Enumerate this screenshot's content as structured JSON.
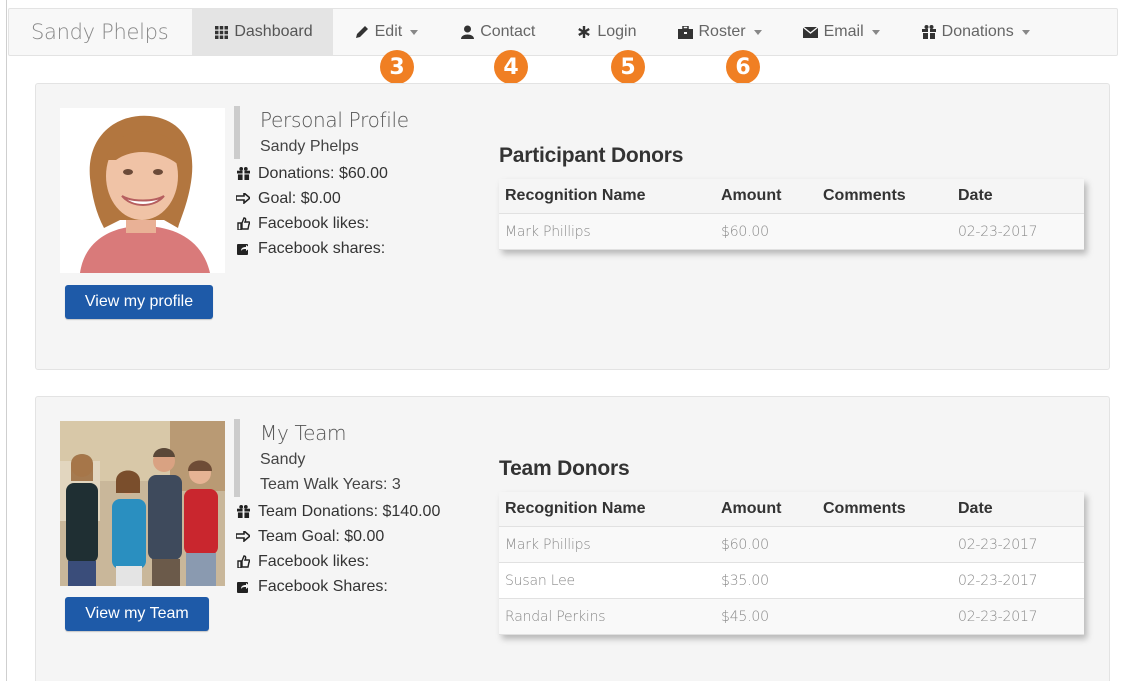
{
  "nav": {
    "brand": "Sandy Phelps",
    "items": [
      {
        "label": "Dashboard",
        "icon": "grid-icon"
      },
      {
        "label": "Edit",
        "icon": "pencil-icon"
      },
      {
        "label": "Contact",
        "icon": "user-icon"
      },
      {
        "label": "Login",
        "icon": "asterisk-icon"
      },
      {
        "label": "Roster",
        "icon": "briefcase-icon"
      },
      {
        "label": "Email",
        "icon": "envelope-icon"
      },
      {
        "label": "Donations",
        "icon": "gift-icon"
      }
    ],
    "badges": [
      "3",
      "4",
      "5",
      "6"
    ],
    "badge_color": "#f07f23"
  },
  "profile": {
    "title": "Personal Profile",
    "name": "Sandy Phelps",
    "donations": "Donations: $60.00",
    "goal": "Goal: $0.00",
    "fb_likes": "Facebook likes:",
    "fb_shares": "Facebook shares:",
    "button": "View my profile",
    "donors_title": "Participant Donors",
    "columns": [
      "Recognition Name",
      "Amount",
      "Comments",
      "Date"
    ],
    "rows": [
      {
        "name": "Mark Phillips",
        "amount": "$60.00",
        "comments": "",
        "date": "02-23-2017"
      }
    ]
  },
  "team": {
    "title": "My Team",
    "name": "Sandy",
    "walk_years": "Team Walk Years: 3",
    "donations": "Team Donations: $140.00",
    "goal": "Team Goal: $0.00",
    "fb_likes": "Facebook likes:",
    "fb_shares": "Facebook Shares:",
    "button": "View my Team",
    "donors_title": "Team Donors",
    "columns": [
      "Recognition Name",
      "Amount",
      "Comments",
      "Date"
    ],
    "rows": [
      {
        "name": "Mark Phillips",
        "amount": "$60.00",
        "comments": "",
        "date": "02-23-2017"
      },
      {
        "name": "Susan Lee",
        "amount": "$35.00",
        "comments": "",
        "date": "02-23-2017"
      },
      {
        "name": "Randal Perkins",
        "amount": "$45.00",
        "comments": "",
        "date": "02-23-2017"
      }
    ]
  },
  "colors": {
    "button": "#1e5aa8",
    "panel": "#f5f5f5"
  }
}
